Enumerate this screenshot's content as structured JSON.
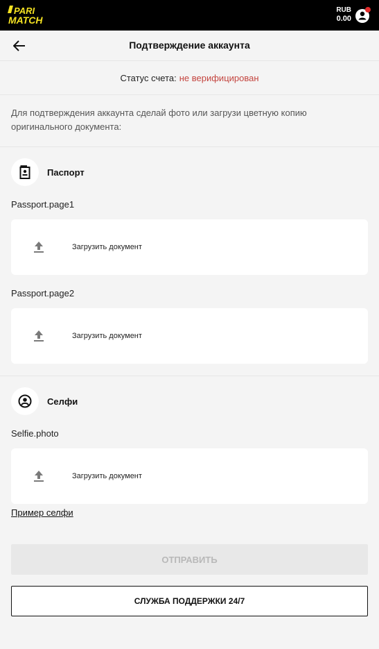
{
  "brand": {
    "logo_text": "PARI MATCH",
    "logo_color": "#f4e222"
  },
  "topbar": {
    "currency": "RUB",
    "balance": "0.00",
    "account_icon": "user-circle-icon",
    "notification_dot_color": "#e12b2b"
  },
  "header": {
    "title": "Подтверждение аккаунта",
    "back_icon": "arrow-left-icon"
  },
  "status": {
    "label": "Статус счета:",
    "value": "не верифицирован",
    "value_color": "#c4453f"
  },
  "instruction": "Для подтверждения аккаунта сделай фото или загрузи цветную копию оригинального документа:",
  "sections": [
    {
      "title": "Паспорт",
      "icon": "passport-icon",
      "documents": [
        {
          "label": "Passport.page1",
          "upload_label": "Загрузить документ",
          "upload_icon": "upload-icon"
        },
        {
          "label": "Passport.page2",
          "upload_label": "Загрузить документ",
          "upload_icon": "upload-icon"
        }
      ]
    },
    {
      "title": "Селфи",
      "icon": "user-icon",
      "documents": [
        {
          "label": "Selfie.photo",
          "upload_label": "Загрузить документ",
          "upload_icon": "upload-icon"
        }
      ]
    }
  ],
  "selfie_example_link": "Пример селфи",
  "buttons": {
    "submit": "ОТПРАВИТЬ",
    "support": "СЛУЖБА ПОДДЕРЖКИ 24/7"
  }
}
